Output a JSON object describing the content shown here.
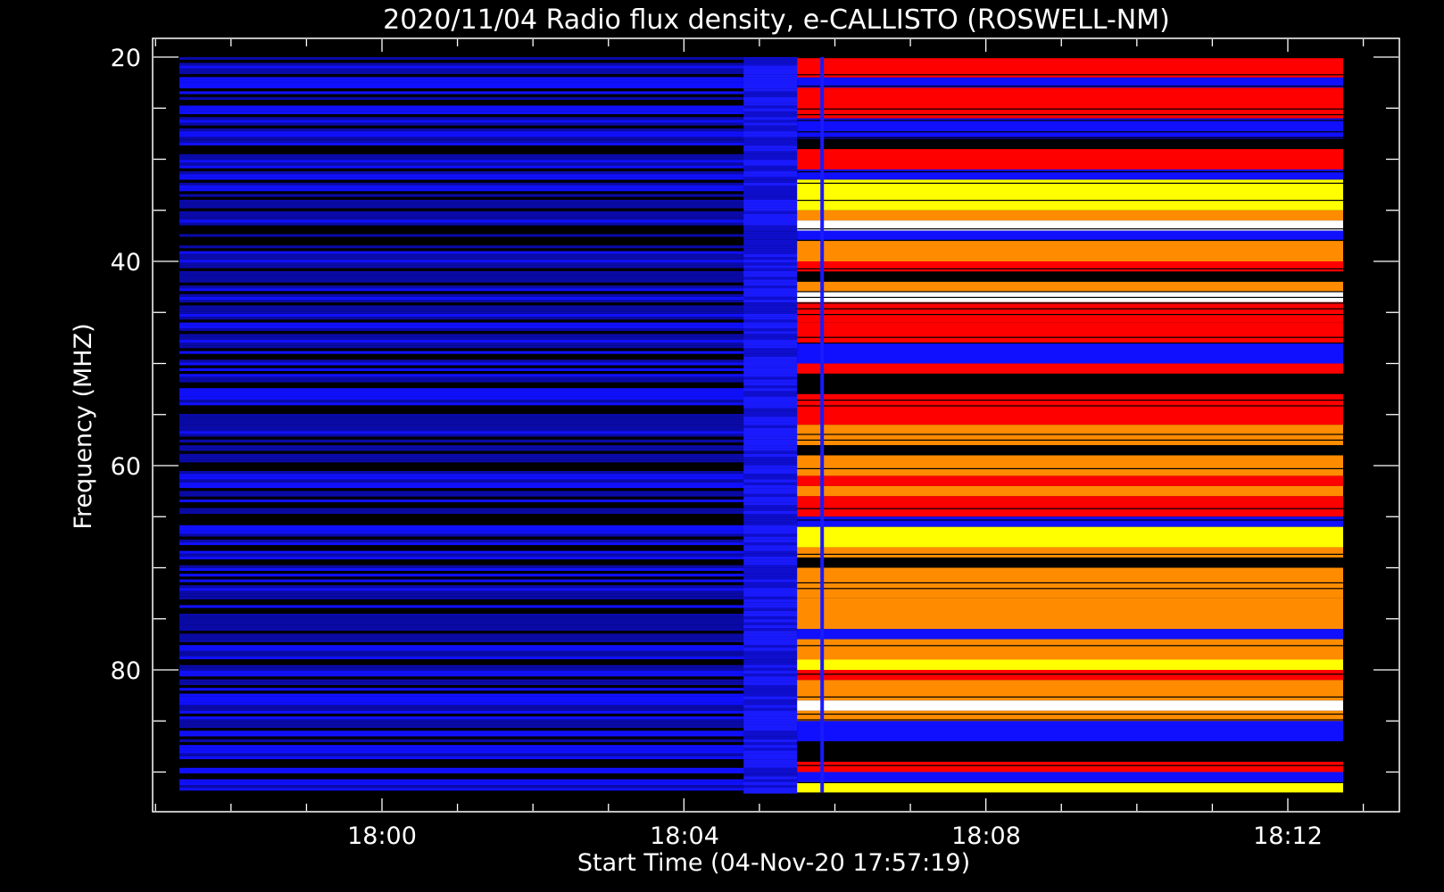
{
  "chart_data": {
    "type": "heatmap",
    "title": "2020/11/04  Radio flux density, e-CALLISTO (ROSWELL-NM)",
    "xlabel": "Start Time (04-Nov-20 17:57:19)",
    "ylabel": "Frequency (MHZ)",
    "x_ticks": [
      "18:00",
      "18:04",
      "18:08",
      "18:12"
    ],
    "y_ticks": [
      "20",
      "40",
      "60",
      "80"
    ],
    "x_range": [
      "17:57:19",
      "18:12:44"
    ],
    "y_range": [
      20,
      92
    ],
    "y_axis_inverted": true,
    "data_time_range": [
      "17:57:19",
      "18:12:44"
    ],
    "event_onset_time": "18:05:30",
    "colormap": [
      "#000000",
      "#1010ff",
      "#ff0000",
      "#ff8c00",
      "#ffff00",
      "#ffffff"
    ],
    "background_color": "#000000",
    "axis_color": "#ffffff"
  }
}
